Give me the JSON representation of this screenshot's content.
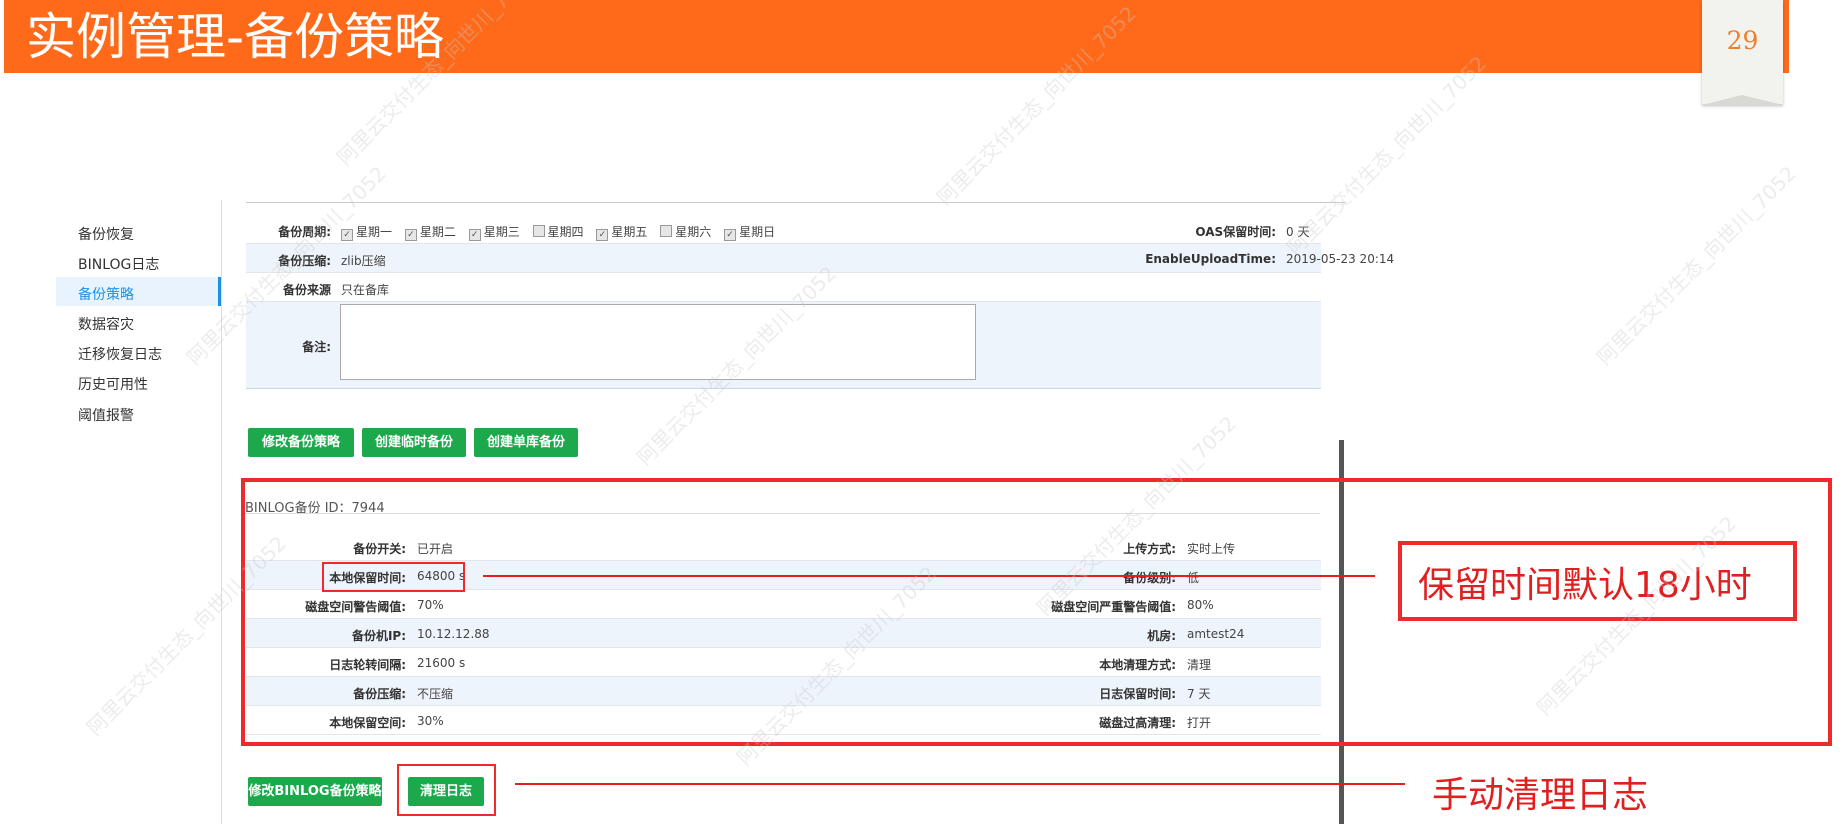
{
  "slide": {
    "title": "实例管理-备份策略",
    "page_number": "29"
  },
  "sidebar": {
    "items": [
      {
        "label": "备份恢复"
      },
      {
        "label": "BINLOG日志"
      },
      {
        "label": "备份策略"
      },
      {
        "label": "数据容灾"
      },
      {
        "label": "迁移恢复日志"
      },
      {
        "label": "历史可用性"
      },
      {
        "label": "阈值报警"
      }
    ]
  },
  "policy": {
    "period_label": "备份周期:",
    "days": [
      {
        "name": "星期一",
        "checked": true
      },
      {
        "name": "星期二",
        "checked": true
      },
      {
        "name": "星期三",
        "checked": true
      },
      {
        "name": "星期四",
        "checked": false
      },
      {
        "name": "星期五",
        "checked": true
      },
      {
        "name": "星期六",
        "checked": false
      },
      {
        "name": "星期日",
        "checked": true
      }
    ],
    "oas_label": "OAS保留时间:",
    "oas_value": "0 天",
    "compress_label": "备份压缩:",
    "compress_value": "zlib压缩",
    "upload_label": "EnableUploadTime:",
    "upload_value": "2019-05-23 20:14",
    "source_label": "备份来源",
    "source_value": "只在备库",
    "remark_label": "备注:"
  },
  "buttons": {
    "modify_policy": "修改备份策略",
    "create_temp": "创建临时备份",
    "create_single": "创建单库备份",
    "modify_binlog": "修改BINLOG备份策略",
    "clean_log": "清理日志"
  },
  "binlog": {
    "title": "BINLOG备份 ID：7944",
    "rows": [
      {
        "l1": "备份开关:",
        "v1": "已开启",
        "l2": "上传方式:",
        "v2": "实时上传"
      },
      {
        "l1": "本地保留时间:",
        "v1": "64800 s",
        "l2": "备份级别:",
        "v2": "低"
      },
      {
        "l1": "磁盘空间警告阈值:",
        "v1": "70%",
        "l2": "磁盘空间严重警告阈值:",
        "v2": "80%"
      },
      {
        "l1": "备份机IP:",
        "v1": "10.12.12.88",
        "l2": "机房:",
        "v2": "amtest24"
      },
      {
        "l1": "日志轮转间隔:",
        "v1": "21600 s",
        "l2": "本地清理方式:",
        "v2": "清理"
      },
      {
        "l1": "备份压缩:",
        "v1": "不压缩",
        "l2": "日志保留时间:",
        "v2": "7 天"
      },
      {
        "l1": "本地保留空间:",
        "v1": "30%",
        "l2": "磁盘过高清理:",
        "v2": "打开"
      }
    ]
  },
  "callouts": {
    "retention": "保留时间默认18小时",
    "manual_clean": "手动清理日志"
  },
  "watermark": "阿里云交付生态_向世川_7052",
  "colors": {
    "title_bar": "#ff6a1a",
    "accent_green": "#1ba94c",
    "annotation_red": "#e02020",
    "active_blue": "#1e90e5"
  }
}
